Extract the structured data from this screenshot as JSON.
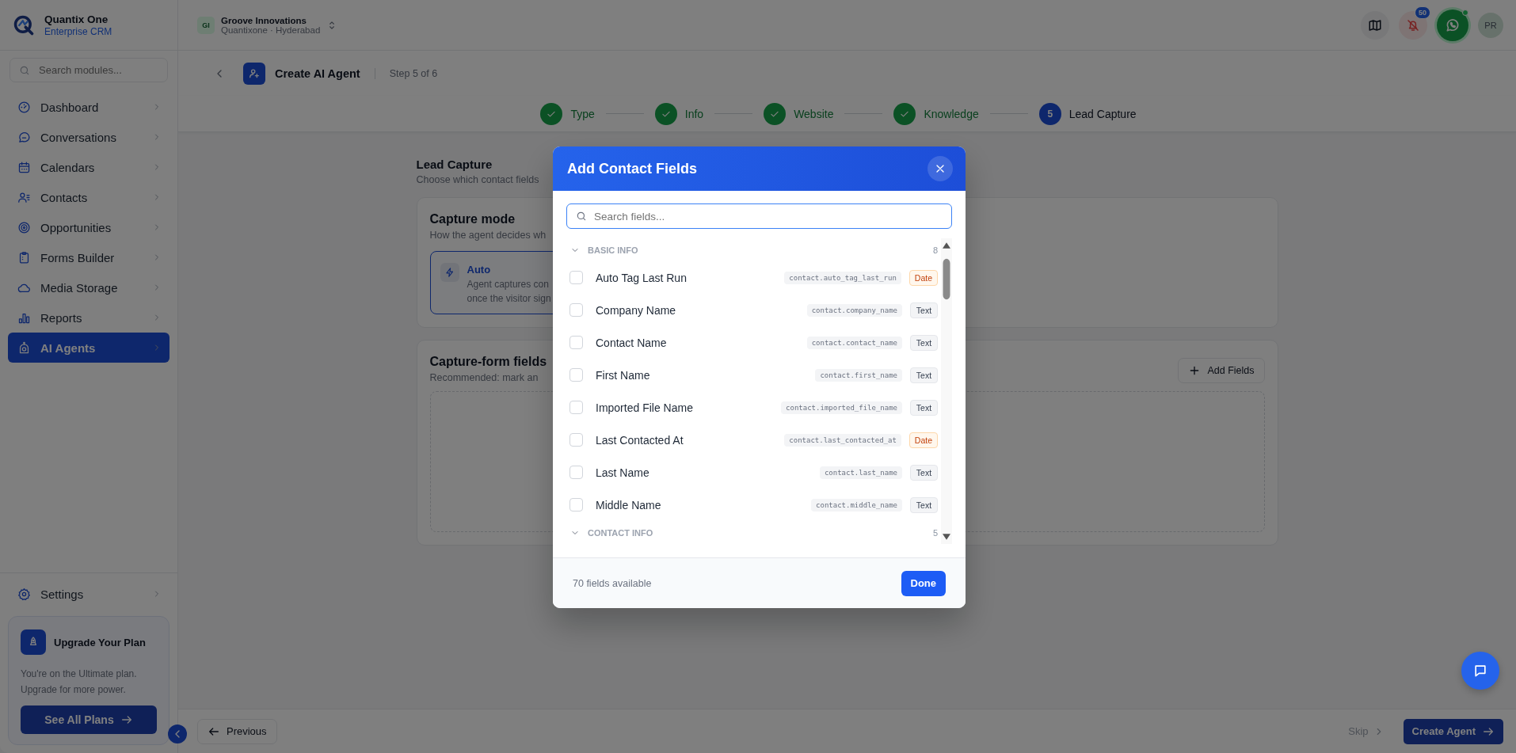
{
  "sidebar": {
    "brand": {
      "name": "Quantix One",
      "tagline": "Enterprise CRM"
    },
    "search": {
      "placeholder": "Search modules..."
    },
    "items": [
      {
        "label": "Dashboard",
        "selected": false
      },
      {
        "label": "Conversations",
        "selected": false
      },
      {
        "label": "Calendars",
        "selected": false
      },
      {
        "label": "Contacts",
        "selected": false
      },
      {
        "label": "Opportunities",
        "selected": false
      },
      {
        "label": "Forms Builder",
        "selected": false
      },
      {
        "label": "Media Storage",
        "selected": false
      },
      {
        "label": "Reports",
        "selected": false
      },
      {
        "label": "AI Agents",
        "selected": true
      }
    ],
    "footer_items": [
      {
        "label": "Settings",
        "selected": false
      }
    ],
    "upgrade": {
      "title": "Upgrade Your Plan",
      "text": "You're on the Ultimate plan. Upgrade for more power.",
      "button": "See All Plans"
    }
  },
  "topbar": {
    "workspace": {
      "initials": "GI",
      "name": "Groove Innovations",
      "location": "Quantixone · Hyderabad"
    },
    "notification_count": "50",
    "avatar": "PR"
  },
  "header": {
    "title": "Create AI Agent",
    "step": "Step 5 of 6"
  },
  "stepper": [
    {
      "label": "Type",
      "completed": true,
      "selected": false
    },
    {
      "label": "Info",
      "completed": true,
      "selected": false
    },
    {
      "label": "Website",
      "completed": true,
      "selected": false
    },
    {
      "label": "Knowledge",
      "completed": true,
      "selected": false
    },
    {
      "label": "Lead Capture",
      "completed": false,
      "selected": true,
      "number": "5"
    }
  ],
  "page": {
    "title": "Lead Capture",
    "subtitle": "Choose which contact fields",
    "capture_mode": {
      "title": "Capture mode",
      "subtitle": "How the agent decides wh",
      "options": [
        {
          "title": "Auto",
          "lines": [
            "Agent captures con",
            "once the visitor sign"
          ],
          "selected": true
        }
      ]
    },
    "capture_form": {
      "title": "Capture-form fields",
      "subtitle": "Recommended: mark an",
      "button": "Add Fields"
    }
  },
  "footer": {
    "previous": "Previous",
    "skip": "Skip",
    "next": "Create Agent"
  },
  "modal": {
    "title": "Add Contact Fields",
    "search": {
      "placeholder": "Search fields..."
    },
    "groups": [
      {
        "name": "BASIC INFO",
        "count": "8",
        "expanded": true,
        "fields": [
          {
            "label": "Auto Tag Last Run",
            "key": "contact.auto_tag_last_run",
            "type": "Date",
            "kind": "date",
            "checked": false
          },
          {
            "label": "Company Name",
            "key": "contact.company_name",
            "type": "Text",
            "kind": "text",
            "checked": false
          },
          {
            "label": "Contact Name",
            "key": "contact.contact_name",
            "type": "Text",
            "kind": "text",
            "checked": false
          },
          {
            "label": "First Name",
            "key": "contact.first_name",
            "type": "Text",
            "kind": "text",
            "checked": false
          },
          {
            "label": "Imported File Name",
            "key": "contact.imported_file_name",
            "type": "Text",
            "kind": "text",
            "checked": false
          },
          {
            "label": "Last Contacted At",
            "key": "contact.last_contacted_at",
            "type": "Date",
            "kind": "date",
            "checked": false
          },
          {
            "label": "Last Name",
            "key": "contact.last_name",
            "type": "Text",
            "kind": "text",
            "checked": false
          },
          {
            "label": "Middle Name",
            "key": "contact.middle_name",
            "type": "Text",
            "kind": "text",
            "checked": false
          }
        ]
      },
      {
        "name": "CONTACT INFO",
        "count": "5",
        "expanded": true
      }
    ],
    "available": "70 fields available",
    "done": "Done"
  }
}
